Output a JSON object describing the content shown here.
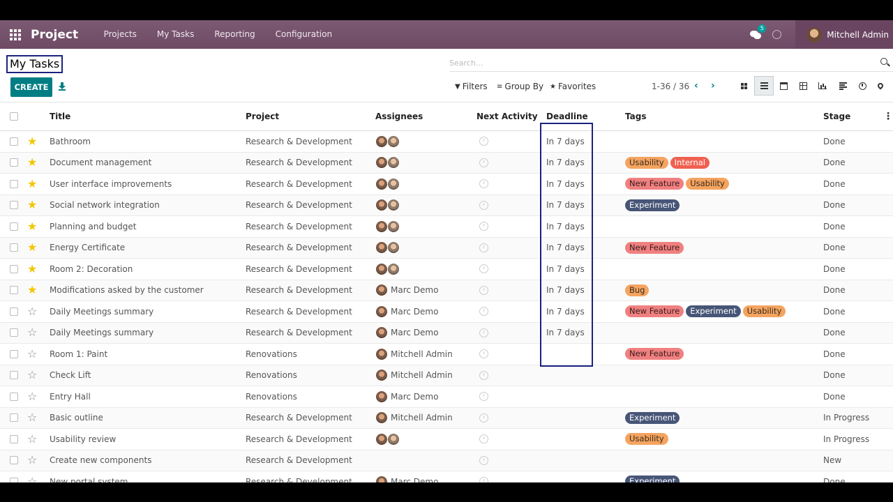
{
  "navbar": {
    "app_name": "Project",
    "menu": [
      "Projects",
      "My Tasks",
      "Reporting",
      "Configuration"
    ],
    "chat_count": "5",
    "user_name": "Mitchell Admin",
    "brand_color": "#714b67"
  },
  "control_panel": {
    "title": "My Tasks",
    "create_label": "CREATE",
    "search_placeholder": "Search...",
    "filters_label": "Filters",
    "groupby_label": "Group By",
    "favorites_label": "Favorites",
    "pager": "1-36 / 36",
    "views": [
      "kanban-icon",
      "list-icon",
      "calendar-icon",
      "pivot-icon",
      "graph-icon",
      "gantt-icon",
      "activity-icon",
      "map-icon"
    ],
    "active_view": "list-icon"
  },
  "table": {
    "headers": {
      "title": "Title",
      "project": "Project",
      "assignees": "Assignees",
      "activity": "Next Activity",
      "deadline": "Deadline",
      "tags": "Tags",
      "stage": "Stage"
    },
    "rows": [
      {
        "starred": true,
        "title": "Bathroom",
        "project": "Research & Development",
        "assignee_name": "",
        "avatars": 2,
        "deadline": "In 7 days",
        "tags": [],
        "stage": "Done"
      },
      {
        "starred": true,
        "title": "Document management",
        "project": "Research & Development",
        "assignee_name": "",
        "avatars": 2,
        "deadline": "In 7 days",
        "tags": [
          "Usability",
          "Internal"
        ],
        "stage": "Done"
      },
      {
        "starred": true,
        "title": "User interface improvements",
        "project": "Research & Development",
        "assignee_name": "",
        "avatars": 2,
        "deadline": "In 7 days",
        "tags": [
          "New Feature",
          "Usability"
        ],
        "stage": "Done"
      },
      {
        "starred": true,
        "title": "Social network integration",
        "project": "Research & Development",
        "assignee_name": "",
        "avatars": 2,
        "deadline": "In 7 days",
        "tags": [
          "Experiment"
        ],
        "stage": "Done"
      },
      {
        "starred": true,
        "title": "Planning and budget",
        "project": "Research & Development",
        "assignee_name": "",
        "avatars": 2,
        "deadline": "In 7 days",
        "tags": [],
        "stage": "Done"
      },
      {
        "starred": true,
        "title": "Energy Certificate",
        "project": "Research & Development",
        "assignee_name": "",
        "avatars": 2,
        "deadline": "In 7 days",
        "tags": [
          "New Feature"
        ],
        "stage": "Done"
      },
      {
        "starred": true,
        "title": "Room 2: Decoration",
        "project": "Research & Development",
        "assignee_name": "",
        "avatars": 2,
        "deadline": "In 7 days",
        "tags": [],
        "stage": "Done"
      },
      {
        "starred": true,
        "title": "Modifications asked by the customer",
        "project": "Research & Development",
        "assignee_name": "Marc Demo",
        "avatars": 1,
        "deadline": "In 7 days",
        "tags": [
          "Bug"
        ],
        "stage": "Done"
      },
      {
        "starred": false,
        "title": "Daily Meetings summary",
        "project": "Research & Development",
        "assignee_name": "Marc Demo",
        "avatars": 1,
        "deadline": "In 7 days",
        "tags": [
          "New Feature",
          "Experiment",
          "Usability"
        ],
        "stage": "Done"
      },
      {
        "starred": false,
        "title": "Daily Meetings summary",
        "project": "Research & Development",
        "assignee_name": "Marc Demo",
        "avatars": 1,
        "deadline": "In 7 days",
        "tags": [],
        "stage": "Done"
      },
      {
        "starred": false,
        "title": "Room 1: Paint",
        "project": "Renovations",
        "assignee_name": "Mitchell Admin",
        "avatars": 1,
        "deadline": "",
        "tags": [
          "New Feature"
        ],
        "stage": "Done"
      },
      {
        "starred": false,
        "title": "Check Lift",
        "project": "Renovations",
        "assignee_name": "Mitchell Admin",
        "avatars": 1,
        "deadline": "",
        "tags": [],
        "stage": "Done"
      },
      {
        "starred": false,
        "title": "Entry Hall",
        "project": "Renovations",
        "assignee_name": "Marc Demo",
        "avatars": 1,
        "deadline": "",
        "tags": [],
        "stage": "Done"
      },
      {
        "starred": false,
        "title": "Basic outline",
        "project": "Research & Development",
        "assignee_name": "Mitchell Admin",
        "avatars": 1,
        "deadline": "",
        "tags": [
          "Experiment"
        ],
        "stage": "In Progress"
      },
      {
        "starred": false,
        "title": "Usability review",
        "project": "Research & Development",
        "assignee_name": "",
        "avatars": 2,
        "deadline": "",
        "tags": [
          "Usability"
        ],
        "stage": "In Progress"
      },
      {
        "starred": false,
        "title": "Create new components",
        "project": "Research & Development",
        "assignee_name": "",
        "avatars": 0,
        "deadline": "",
        "tags": [],
        "stage": "New"
      },
      {
        "starred": false,
        "title": "New portal system",
        "project": "Research & Development",
        "assignee_name": "Marc Demo",
        "avatars": 1,
        "deadline": "",
        "tags": [
          "Experiment"
        ],
        "stage": "Done"
      }
    ]
  },
  "tag_colors": {
    "Usability": "usability",
    "Internal": "internal",
    "New Feature": "newfeature",
    "Experiment": "experiment",
    "Bug": "bug"
  }
}
